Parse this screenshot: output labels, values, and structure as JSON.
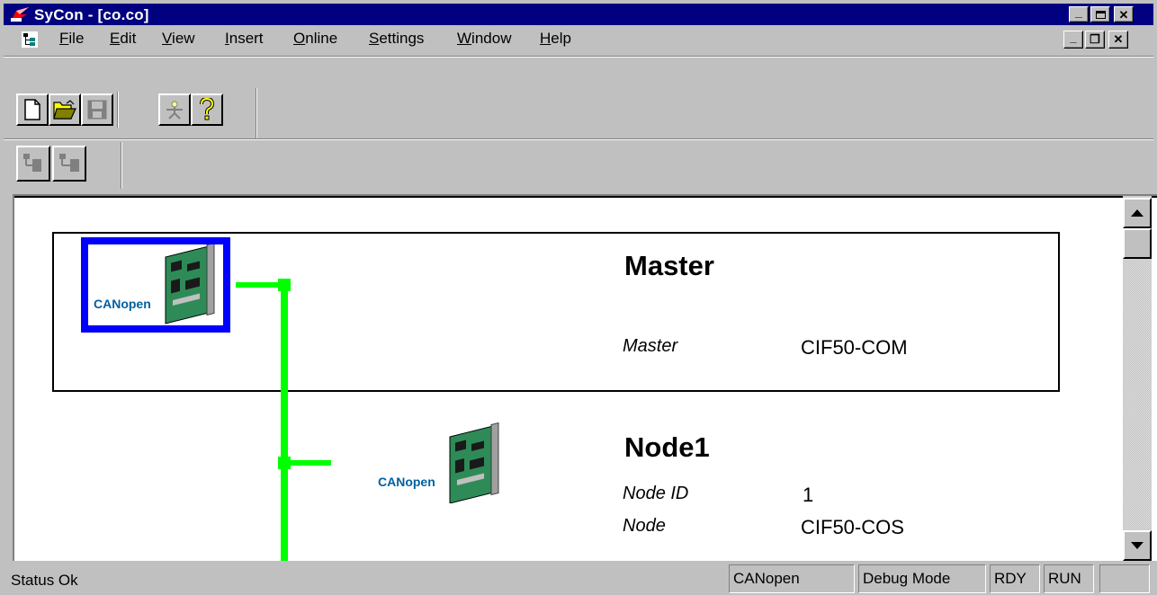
{
  "window": {
    "title": "SyCon - [co.co]",
    "controls": {
      "minimize": "_",
      "maximize": "□",
      "close": "✕"
    }
  },
  "menu": {
    "items": [
      {
        "label_u": "F",
        "label_rest": "ile"
      },
      {
        "label_u": "E",
        "label_rest": "dit"
      },
      {
        "label_u": "V",
        "label_rest": "iew"
      },
      {
        "label_u": "I",
        "label_rest": "nsert"
      },
      {
        "label_u": "O",
        "label_rest": "nline"
      },
      {
        "label_u": "S",
        "label_rest": "ettings"
      },
      {
        "label_u": "W",
        "label_rest": "indow"
      },
      {
        "label_u": "H",
        "label_rest": "elp"
      }
    ],
    "mdi_controls": {
      "minimize": "_",
      "restore": "❐",
      "close": "✕"
    }
  },
  "toolbar1": {
    "buttons": [
      "new-document-icon",
      "open-folder-icon",
      "save-disk-icon",
      "wizard-icon",
      "help-icon"
    ]
  },
  "toolbar2": {
    "buttons": [
      "insert-device-left-icon",
      "insert-device-right-icon"
    ]
  },
  "network": {
    "master": {
      "title": "Master",
      "label": "Master",
      "value": "CIF50-COM",
      "selected": true,
      "logo": "CANopen"
    },
    "nodes": [
      {
        "title": "Node1",
        "rows": [
          {
            "label": "Node ID",
            "value": "1"
          },
          {
            "label": "Node",
            "value": "CIF50-COS"
          }
        ],
        "logo": "CANopen"
      }
    ]
  },
  "colors": {
    "titlebar": "#000080",
    "bus_line": "#00ff00",
    "selection": "#0000ff",
    "chrome": "#c0c0c0"
  },
  "statusbar": {
    "status": "Status Ok",
    "panels": [
      "CANopen",
      "Debug Mode",
      "RDY",
      "RUN",
      ""
    ]
  }
}
